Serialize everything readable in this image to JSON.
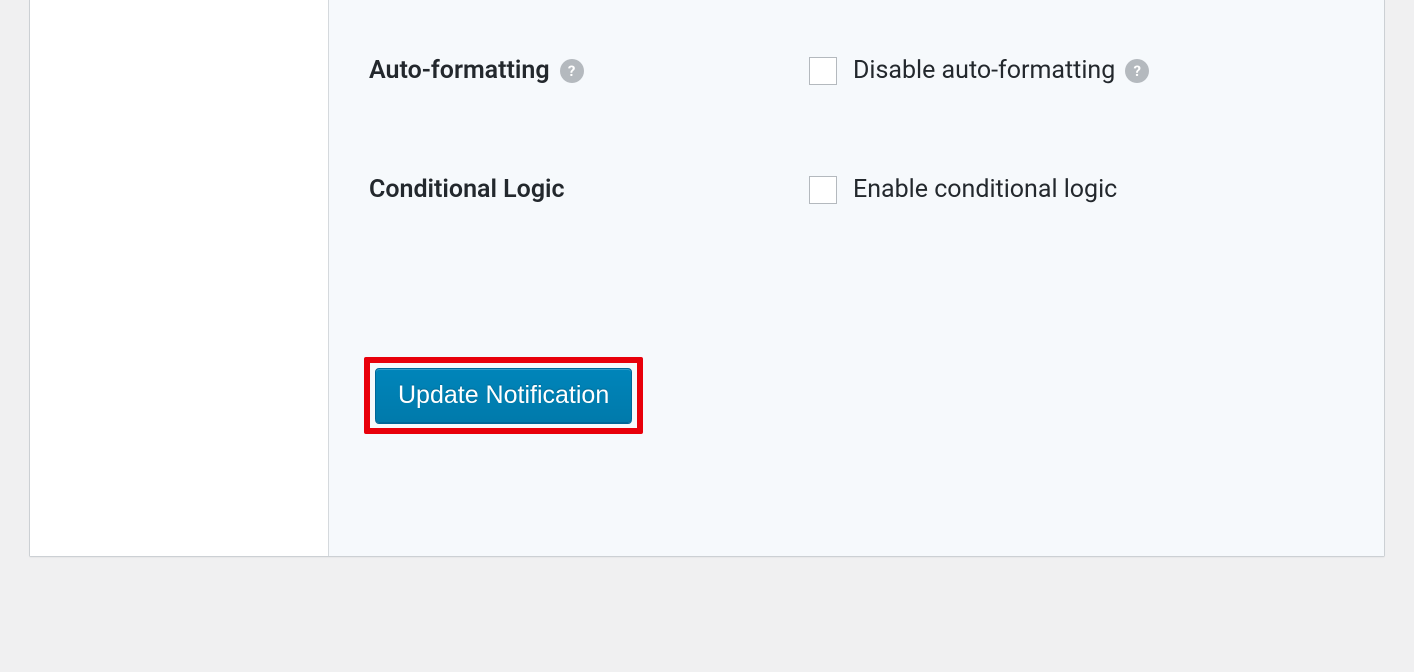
{
  "settings": {
    "auto_formatting": {
      "label": "Auto-formatting",
      "checkbox_label": "Disable auto-formatting"
    },
    "conditional_logic": {
      "label": "Conditional Logic",
      "checkbox_label": "Enable conditional logic"
    }
  },
  "actions": {
    "update_button": "Update Notification"
  }
}
